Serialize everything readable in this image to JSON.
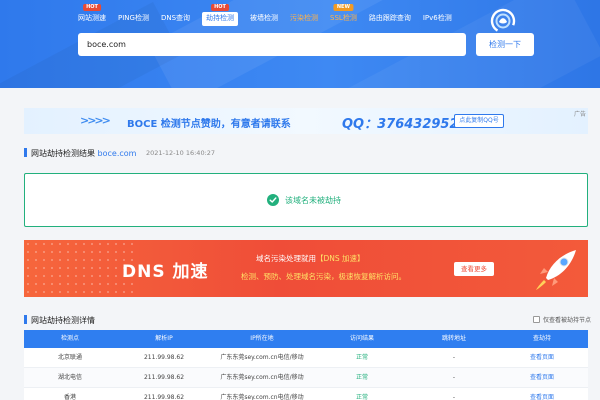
{
  "nav": {
    "items": [
      {
        "label": "网站测速",
        "badge": "HOT"
      },
      {
        "label": "PING检测",
        "badge": ""
      },
      {
        "label": "DNS查询",
        "badge": ""
      },
      {
        "label": "劫持检测",
        "badge": "HOT"
      },
      {
        "label": "被墙检测",
        "badge": ""
      },
      {
        "label": "污染检测",
        "badge": ""
      },
      {
        "label": "SSL检测",
        "badge": "NEW"
      },
      {
        "label": "路由跟踪查询",
        "badge": ""
      },
      {
        "label": "IPv6检测",
        "badge": ""
      }
    ],
    "active_index": 3
  },
  "search": {
    "value": "boce.com",
    "button_label": "检测一下"
  },
  "ad_banner": {
    "chevrons": ">>>>",
    "text": "BOCE 检测节点赞助，有意者请联系",
    "qq": "QQ：376432952",
    "button_label": "点此复制QQ号",
    "tag": "广告"
  },
  "result": {
    "title": "网站劫持检测结果",
    "domain": "boce.com",
    "timestamp": "2021-12-10 16:40:27",
    "message": "该域名未被劫持"
  },
  "dns_ad": {
    "title": "DNS 加速",
    "line1_prefix": "域名污染处理就用",
    "line1_highlight": "【DNS 加速】",
    "line2": "检测、预防、处理域名污染，极速恢复解析访问。",
    "button_label": "查看更多"
  },
  "details": {
    "title": "网站劫持检测详情",
    "filter_label": "仅查看被劫持节点",
    "columns": [
      "检测点",
      "解析IP",
      "IP所在地",
      "访问结果",
      "跳转地址",
      "查劫持"
    ],
    "rows": [
      [
        "北京联通",
        "211.99.98.62",
        "广东东莞sey.com.cn电信/移动",
        "正常",
        "-",
        "查看页面"
      ],
      [
        "湖北电信",
        "211.99.98.62",
        "广东东莞sey.com.cn电信/移动",
        "正常",
        "-",
        "查看页面"
      ],
      [
        "香港",
        "211.99.98.62",
        "广东东莞sey.com.cn电信/移动",
        "正常",
        "-",
        "查看页面"
      ]
    ]
  },
  "colors": {
    "primary": "#2f79ec",
    "success": "#22b07d",
    "ad_red": "#ef4d38",
    "hot": "#e94a34",
    "new": "#f29a23"
  }
}
